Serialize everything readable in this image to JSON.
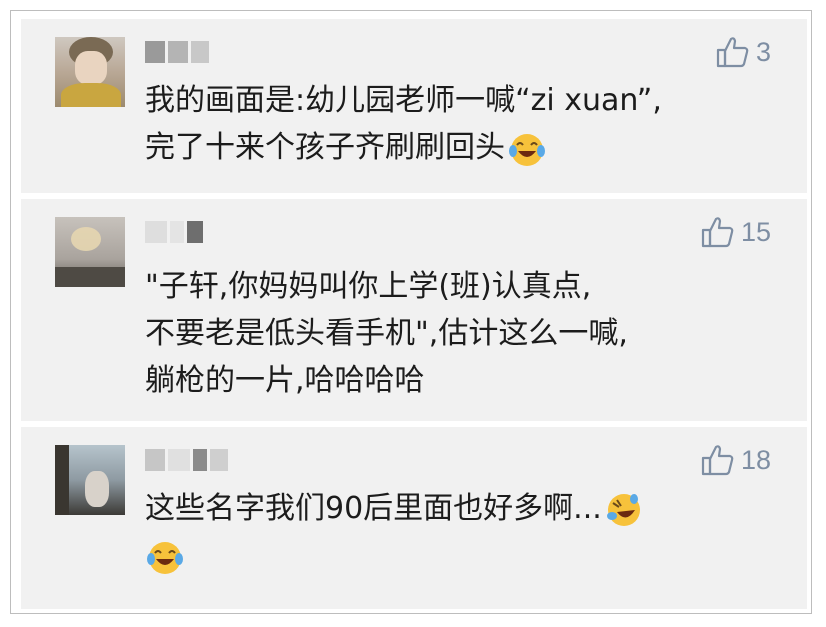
{
  "comments": [
    {
      "likes": "3",
      "lines": [
        "我的画面是:幼儿园老师一喊“zi xuan”,",
        "完了十来个孩子齐刷刷回头"
      ],
      "emojis": [
        "laughing-tears"
      ]
    },
    {
      "likes": "15",
      "lines": [
        "\"子轩,你妈妈叫你上学(班)认真点,",
        "不要老是低头看手机\",估计这么一喊,",
        "躺枪的一片,哈哈哈哈"
      ],
      "emojis": []
    },
    {
      "likes": "18",
      "lines": [
        "这些名字我们90后里面也好多啊..."
      ],
      "emojis": [
        "rolling-laugh",
        "laughing-tears"
      ]
    }
  ],
  "colors": {
    "card_bg": "#f1f1f1",
    "like_icon": "#7e8ea3",
    "text": "#1c1c1c",
    "emoji_face": "#f7c23b"
  }
}
